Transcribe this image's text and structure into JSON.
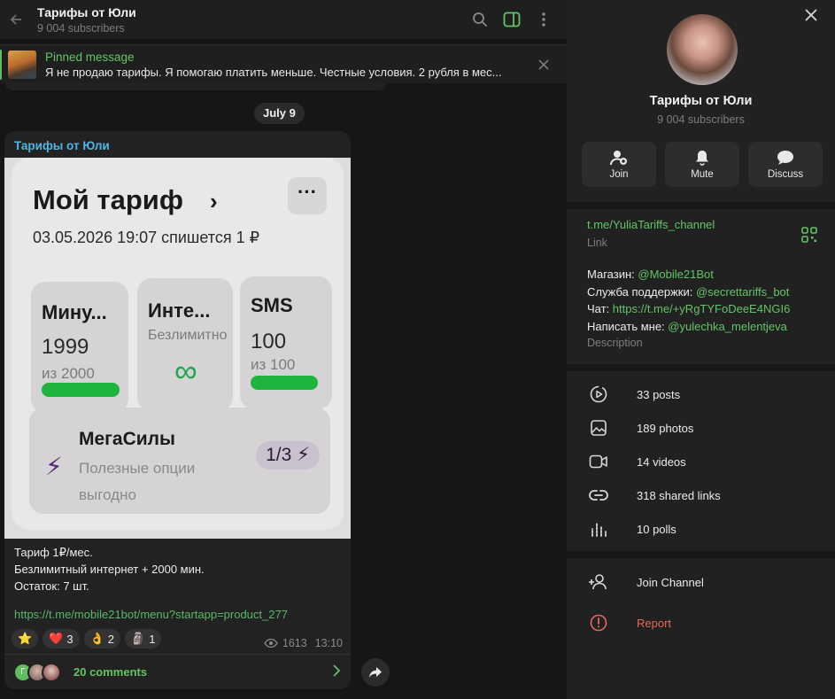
{
  "chat": {
    "title": "Тарифы от Юли",
    "subscribers": "9 004 subscribers",
    "pinned": {
      "label": "Pinned message",
      "text": "Я не продаю тарифы. Я помогаю платить меньше.  Честные условия. 2 рубля в мес..."
    },
    "date_pill": "July 9",
    "message": {
      "author": "Тарифы от Юли",
      "photo": {
        "title": "Мой тариф",
        "chevron": "›",
        "menu": "···",
        "date_line": "03.05.2026 19:07 спишется 1 ₽",
        "tiles": [
          {
            "name": "Мину...",
            "value": "1999",
            "of": "из 2000",
            "fill": 1999
          },
          {
            "name": "Инте...",
            "value": "Безлимитно",
            "symbol": "∞"
          },
          {
            "name": "SMS",
            "value": "100",
            "of": "из 100",
            "fill": 100
          }
        ],
        "mega": {
          "name": "МегаСилы",
          "desc": "Полезные опции выгодно",
          "pill": "1/3 ⚡",
          "bolt": "⚡"
        }
      },
      "caption_lines": [
        "Тариф 1₽/мес.",
        "Безлимитный интернет + 2000 мин.",
        "Остаток: 7 шт."
      ],
      "link": "https://t.me/mobile21bot/menu?startapp=product_277",
      "reactions": [
        {
          "emoji": "⭐",
          "count": ""
        },
        {
          "emoji": "❤️",
          "count": "3"
        },
        {
          "emoji": "👌",
          "count": "2"
        },
        {
          "emoji": "🗿",
          "count": "1"
        }
      ],
      "views": "1613",
      "time": "13:10",
      "comments": "20 comments",
      "comment_avatar_letter": "Г"
    }
  },
  "side": {
    "name": "Тарифы от Юли",
    "subscribers": "9 004 subscribers",
    "actions": [
      {
        "label": "Join",
        "icon": "add-user-icon"
      },
      {
        "label": "Mute",
        "icon": "bell-icon"
      },
      {
        "label": "Discuss",
        "icon": "chat-bubble-icon"
      }
    ],
    "link": "t.me/YuliaTariffs_channel",
    "link_label": "Link",
    "desc": {
      "shop_label": "Магазин: ",
      "shop": "@Mobile21Bot",
      "support_label": "Служба поддержки: ",
      "support": "@secrettariffs_bot",
      "chat_label": "Чат: ",
      "chat": "https://t.me/+yRgTYFoDeeE4NGI6",
      "write_label": "Написать мне: ",
      "write": "@yulechka_melentjeva"
    },
    "desc_label": "Description",
    "media": [
      {
        "label": "33 posts",
        "icon": "posts-icon"
      },
      {
        "label": "189 photos",
        "icon": "photo-icon"
      },
      {
        "label": "14 videos",
        "icon": "video-icon"
      },
      {
        "label": "318 shared links",
        "icon": "link-icon"
      },
      {
        "label": "10 polls",
        "icon": "poll-icon"
      }
    ],
    "join_channel": "Join Channel",
    "report": "Report"
  },
  "colors": {
    "accent_green": "#63c466",
    "author_blue": "#4fb7e8",
    "report_red": "#e6655f",
    "bar_green": "#1fb43c"
  }
}
